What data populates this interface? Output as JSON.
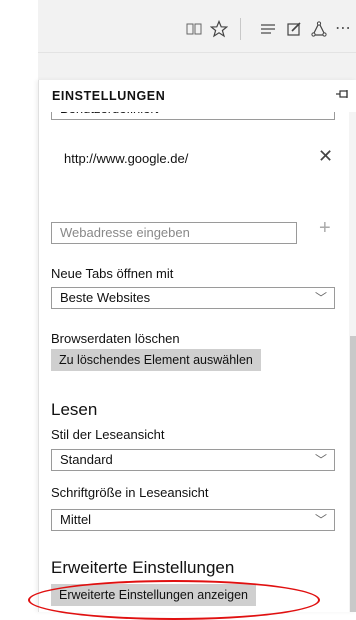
{
  "toolbar": {
    "icons": [
      "reading-view-icon",
      "favorites-star-icon",
      "hub-icon",
      "web-note-icon",
      "share-icon",
      "more-icon"
    ]
  },
  "settings": {
    "title": "EINSTELLUNGEN",
    "startpage_select_value": "Benutzerdefiniert",
    "startpage_url": "http://www.google.de/",
    "url_input_placeholder": "Webadresse eingeben",
    "new_tabs_label": "Neue Tabs öffnen mit",
    "new_tabs_value": "Beste Websites",
    "clear_data_label": "Browserdaten löschen",
    "clear_data_button": "Zu löschendes Element auswählen",
    "reading_section": "Lesen",
    "reading_style_label": "Stil der Leseansicht",
    "reading_style_value": "Standard",
    "font_size_label": "Schriftgröße in Leseansicht",
    "font_size_value": "Mittel",
    "advanced_section": "Erweiterte Einstellungen",
    "advanced_button": "Erweiterte Einstellungen anzeigen"
  },
  "colors": {
    "toolbar_bg": "#f2f2f2",
    "button_bg": "#cfcfcf",
    "highlight": "#e01010"
  }
}
